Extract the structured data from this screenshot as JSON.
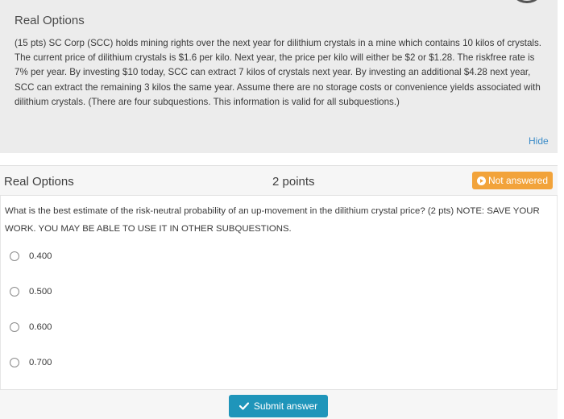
{
  "info": {
    "title": "Real Options",
    "body": "(15 pts) SC Corp (SCC) holds mining rights over the next year for dilithium crystals in a mine which contains 10 kilos of crystals. The current price of dilithium crystals is $1.6 per kilo. Next year, the price per kilo will either be $2 or $1.28. The riskfree rate is 7% per year. By investing $10 today, SCC can extract 7 kilos of crystals next year. By investing an additional $4.28 next year, SCC can extract the remaining 3 kilos the same year. Assume there are no storage costs or convenience yields associated with dilithium crystals. (There are four subquestions. This information is valid for all subquestions.)",
    "hide_label": "Hide"
  },
  "question": {
    "title": "Real Options",
    "points": "2 points",
    "status": "Not answered",
    "text": "What is the best estimate of the risk-neutral probability of an up-movement in the dilithium crystal price? (2 pts) NOTE: SAVE YOUR WORK.  YOU MAY BE ABLE TO USE IT IN OTHER SUBQUESTIONS.",
    "choices": [
      "0.400",
      "0.500",
      "0.600",
      "0.700"
    ]
  },
  "footer": {
    "submit_label": "Submit answer"
  },
  "colors": {
    "status_badge": "#f2a33a",
    "submit_button": "#1f95ba",
    "hide_link": "#3a8bc8"
  },
  "icons": {
    "status": "play-circle-icon",
    "submit": "check-icon"
  }
}
